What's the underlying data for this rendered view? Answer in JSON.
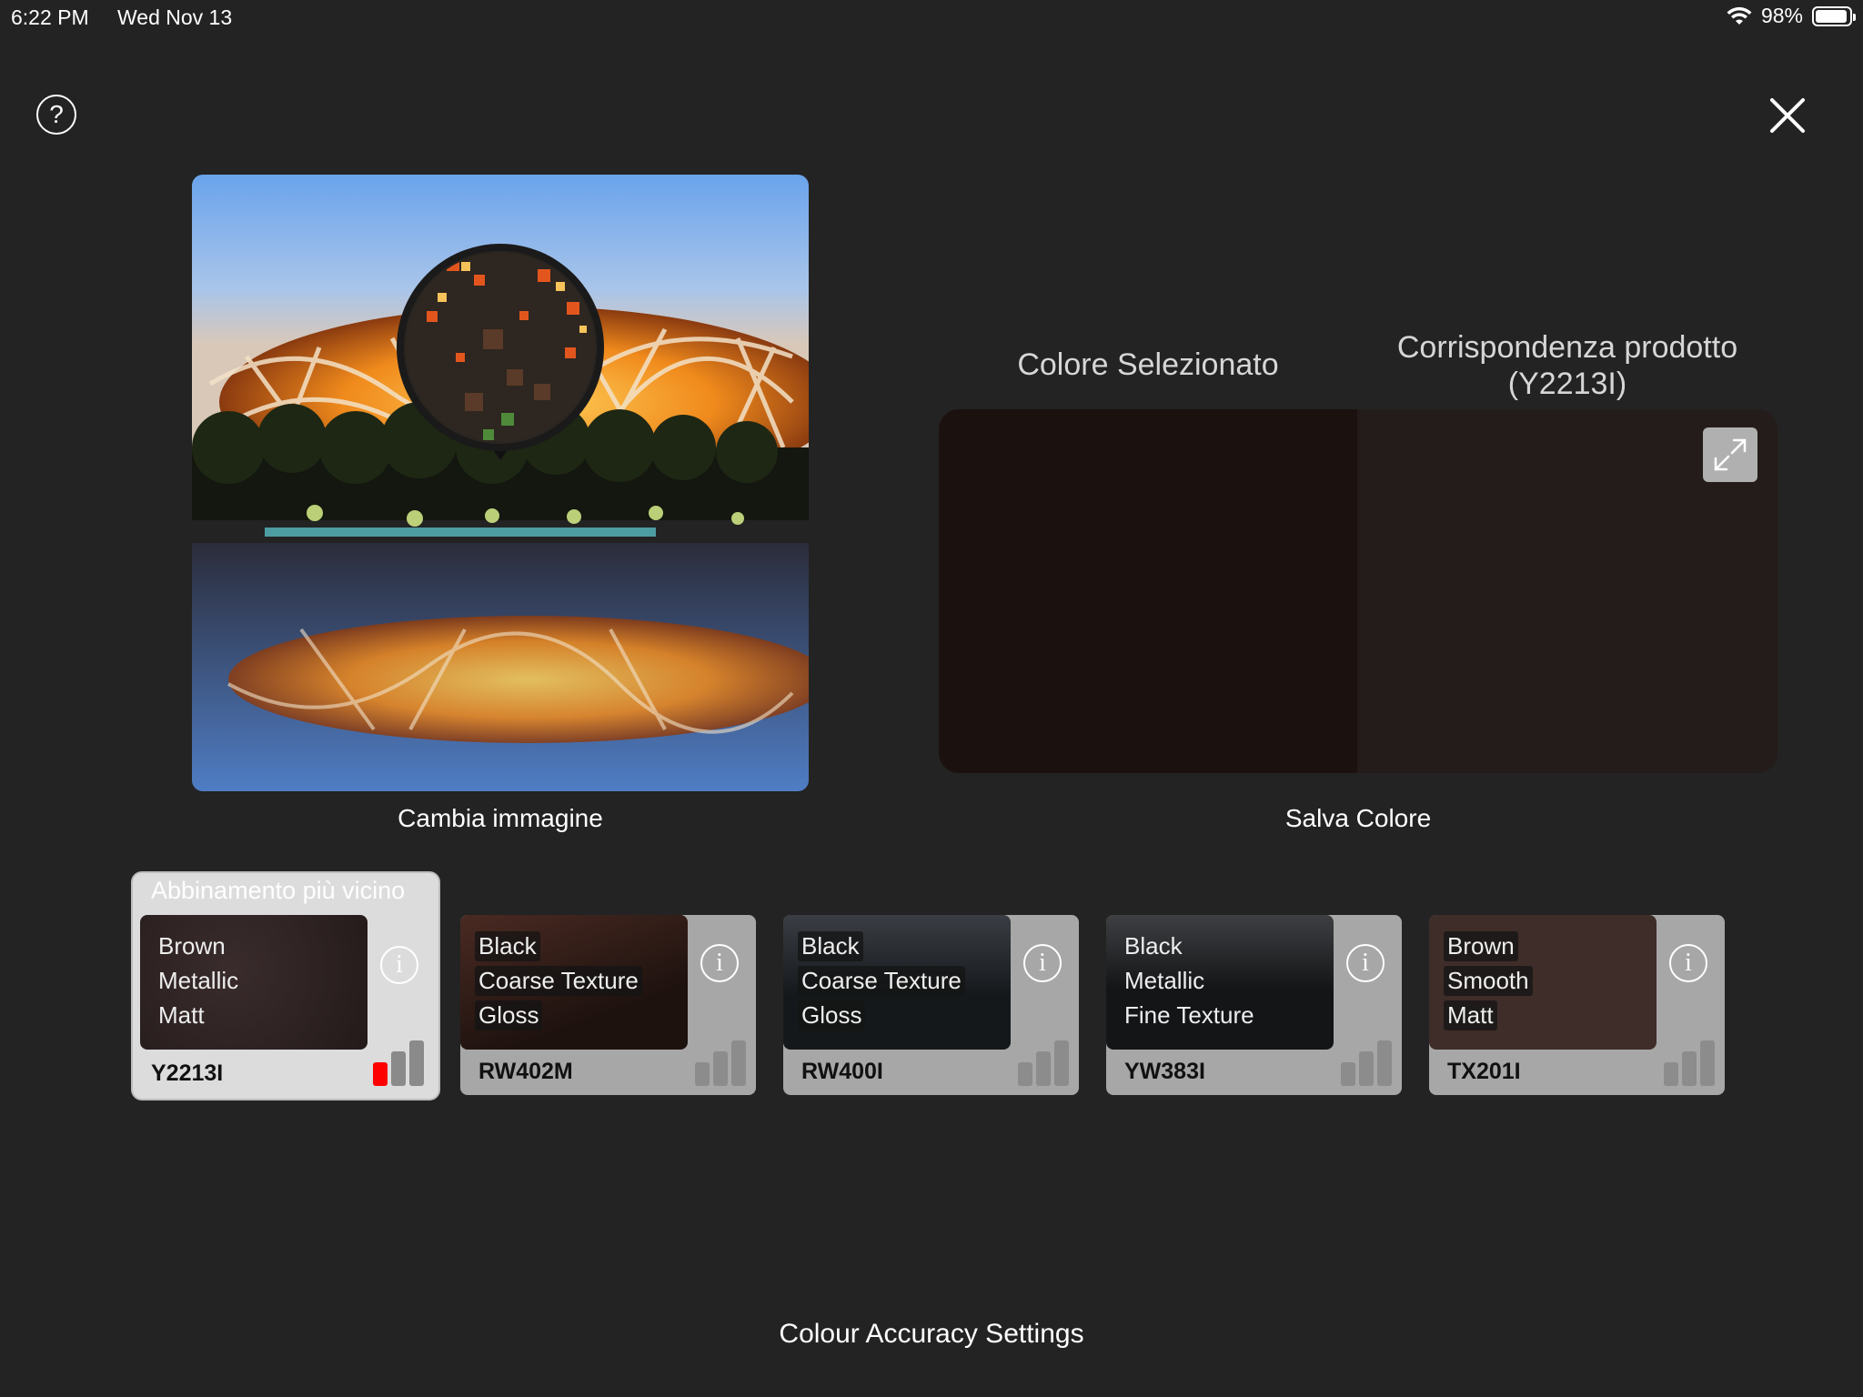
{
  "status_bar": {
    "time": "6:22 PM",
    "date": "Wed Nov 13",
    "battery": "98%",
    "battery_level": 0.98
  },
  "header": {
    "help_icon": "question-circle-icon",
    "close_icon": "close-x-icon"
  },
  "image_panel": {
    "change_image_label": "Cambia immagine"
  },
  "comparison": {
    "selected_title": "Colore Selezionato",
    "match_title_line1": "Corrispondenza prodotto",
    "match_title_line2": "(Y2213I)",
    "selected_color": "#1b1210",
    "match_color": "#241c1a",
    "save_label": "Salva Colore"
  },
  "matches": {
    "closest_heading": "Abbinamento più vicino",
    "cards": [
      {
        "tags": [
          "Brown",
          "Metallic",
          "Matt"
        ],
        "code": "Y2213I",
        "swatch": "#2a1f1f",
        "accuracy": 1
      },
      {
        "tags": [
          "Black",
          "Coarse Texture",
          "Gloss"
        ],
        "code": "RW402M",
        "swatch": "#3a1d17",
        "accuracy": 0
      },
      {
        "tags": [
          "Black",
          "Coarse Texture",
          "Gloss"
        ],
        "code": "RW400I",
        "swatch": "#1c2024",
        "accuracy": 0
      },
      {
        "tags": [
          "Black",
          "Metallic",
          "Fine Texture"
        ],
        "code": "YW383I",
        "swatch": "#1e1f21",
        "accuracy": 0
      },
      {
        "tags": [
          "Brown",
          "Smooth",
          "Matt"
        ],
        "code": "TX201I",
        "swatch": "#3f2d29",
        "accuracy": 0
      }
    ]
  },
  "footer": {
    "settings_label": "Colour Accuracy Settings"
  }
}
